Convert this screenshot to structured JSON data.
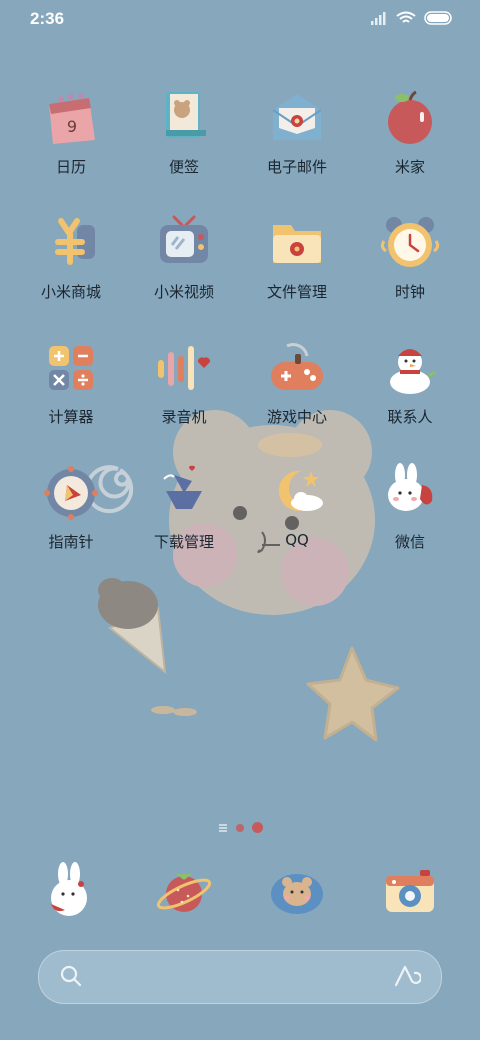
{
  "status_bar": {
    "time": "2:36",
    "icons": [
      "signal-icon",
      "wifi-icon",
      "battery-icon"
    ]
  },
  "apps": [
    {
      "label": "日历",
      "icon": "calendar-icon",
      "icon_text": "9"
    },
    {
      "label": "便签",
      "icon": "notes-icon"
    },
    {
      "label": "电子邮件",
      "icon": "email-icon"
    },
    {
      "label": "米家",
      "icon": "apple-icon"
    },
    {
      "label": "小米商城",
      "icon": "shop-icon"
    },
    {
      "label": "小米视频",
      "icon": "tv-icon"
    },
    {
      "label": "文件管理",
      "icon": "folder-icon"
    },
    {
      "label": "时钟",
      "icon": "clock-icon"
    },
    {
      "label": "计算器",
      "icon": "calculator-icon"
    },
    {
      "label": "录音机",
      "icon": "recorder-icon"
    },
    {
      "label": "游戏中心",
      "icon": "gamepad-icon"
    },
    {
      "label": "联系人",
      "icon": "snowman-icon"
    },
    {
      "label": "指南针",
      "icon": "compass-icon"
    },
    {
      "label": "下载管理",
      "icon": "download-icon"
    },
    {
      "label": "QQ",
      "icon": "moon-cloud-icon"
    },
    {
      "label": "微信",
      "icon": "bunny-strawberry-icon"
    }
  ],
  "dock": [
    {
      "icon": "bunny-icon"
    },
    {
      "icon": "strawberry-planet-icon"
    },
    {
      "icon": "bear-cloud-icon"
    },
    {
      "icon": "camera-icon"
    }
  ],
  "page_indicator": {
    "pages": 2,
    "active": 1
  },
  "colors": {
    "background": "#86a7bc",
    "label": "#1b2630"
  }
}
